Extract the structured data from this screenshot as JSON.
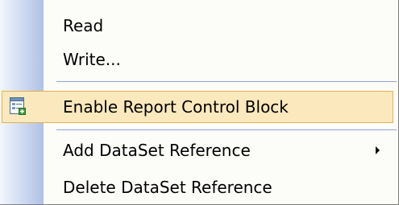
{
  "menu": {
    "items": [
      {
        "label": "Read"
      },
      {
        "label": "Write..."
      },
      {
        "label": "Enable Report Control Block",
        "icon": "report-control-block-icon",
        "highlighted": true
      },
      {
        "label": "Add DataSet Reference",
        "has_submenu": true
      },
      {
        "label": "Delete DataSet Reference"
      }
    ]
  },
  "colors": {
    "highlight_fill": "#fbe8bd",
    "highlight_border": "#e4b34c",
    "gutter_gradient_end": "#afc1e6",
    "separator": "#8ea7d6"
  }
}
